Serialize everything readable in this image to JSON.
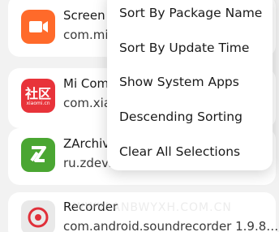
{
  "apps": [
    {
      "name": "Screen R",
      "package": "com.miu",
      "icon": "screen-recorder-camera-icon"
    },
    {
      "name": "Mi Comm",
      "package": "com.xia",
      "icon": "mi-community-icon",
      "icon_text": "社区",
      "icon_subtext": "xiaomi.cn"
    },
    {
      "name": "ZArchive",
      "package": "ru.zdevs",
      "icon": "zarchiver-icon"
    },
    {
      "name": "Recorder",
      "package": "com.android.soundrecorder 1.9.8…",
      "icon": "recorder-icon"
    }
  ],
  "menu": {
    "items": [
      "Sort By Package Name",
      "Sort By Update Time",
      "Show System Apps",
      "Descending Sorting",
      "Clear All Selections"
    ]
  },
  "watermark": "WWW.ANBWYXH.COM.CN",
  "colors": {
    "screen_icon": "#ff6a2a",
    "community_icon": "#e8333a",
    "zarchiver_icon": "#4aa632",
    "recorder_accent": "#e0303a"
  }
}
